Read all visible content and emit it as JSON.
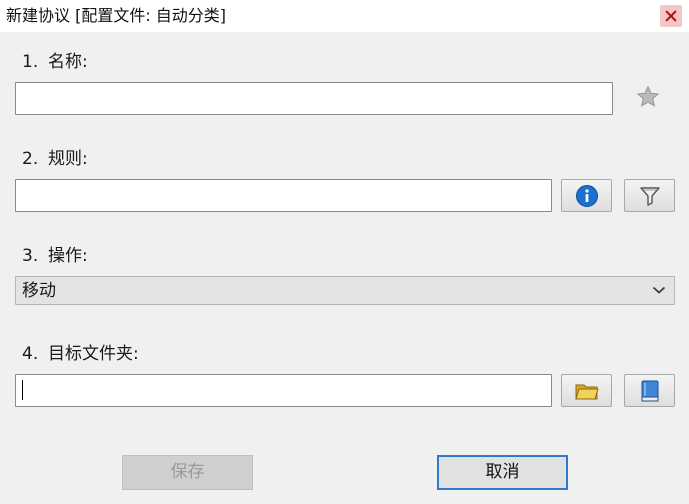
{
  "window": {
    "title": "新建协议 [配置文件: 自动分类]"
  },
  "fields": {
    "name": {
      "number": "1.",
      "label": "名称:",
      "value": ""
    },
    "rule": {
      "number": "2.",
      "label": "规则:",
      "value": ""
    },
    "action": {
      "number": "3.",
      "label": "操作:",
      "selected": "移动"
    },
    "target_folder": {
      "number": "4.",
      "label": "目标文件夹:",
      "value": ""
    }
  },
  "buttons": {
    "save": "保存",
    "cancel": "取消"
  },
  "colors": {
    "focus_border": "#2f78d0",
    "info_icon": "#1a6fd0",
    "folder_icon": "#e8c33a",
    "book_icon": "#3f86d6"
  }
}
